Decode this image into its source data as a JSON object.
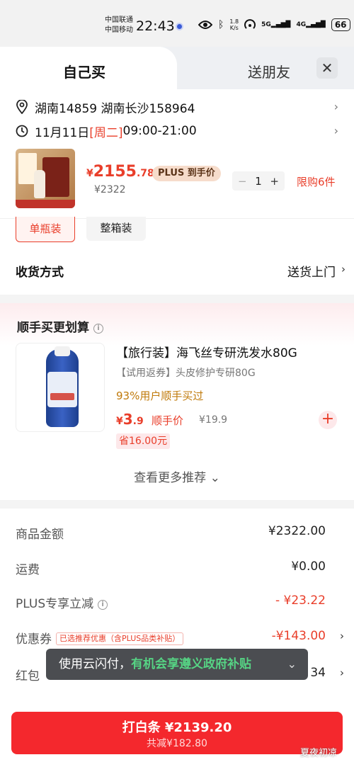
{
  "status_bar": {
    "carrier1": "中国联通",
    "carrier2": "中国移动",
    "time": "22:43",
    "speed_value": "1.8",
    "speed_unit": "K/s",
    "net1": "5G",
    "net2": "4G",
    "battery": "66"
  },
  "tabs": {
    "self_buy": "自己买",
    "gift": "送朋友",
    "close": "✕"
  },
  "delivery": {
    "address": "湖南14859  湖南长沙158964",
    "date": "11月11日 ",
    "weekday": "[周二]",
    "hours": " 09:00-21:00"
  },
  "product": {
    "price_yen": "¥",
    "price_int": "2155",
    "price_dec": ".78",
    "plus_badge": "PLUS 到手价",
    "original_price": "¥2322",
    "quantity": "1",
    "minus": "−",
    "plus": "+",
    "limit": "限购6件",
    "pack_single": "单瓶装",
    "pack_box": "整箱装"
  },
  "shipping": {
    "label": "收货方式",
    "value": "送货上门"
  },
  "upsell": {
    "title": "顺手买更划算",
    "info": "i",
    "name": "【旅行装】海飞丝专研洗发水80G",
    "subtitle": "【试用返券】头皮修护专研80G",
    "buyers": "93%用户顺手买过",
    "price_yen": "¥",
    "price_int": "3",
    "price_dec": ".9",
    "price_tag": "顺手价",
    "original_price": "¥19.9",
    "save": "省16.00元",
    "add": "+",
    "more": "查看更多推荐 ⌄"
  },
  "summary": {
    "goods_label": "商品金额",
    "goods_value": "¥2322.00",
    "freight_label": "运费",
    "freight_value": "¥0.00",
    "plus_label": "PLUS专享立减",
    "plus_value": "- ¥23.22",
    "coupon_label": "优惠券",
    "coupon_tag": "已选推荐优惠（含PLUS品类补贴）",
    "coupon_value": "-¥143.00",
    "redpacket_label": "红包",
    "redpacket_value": "34"
  },
  "toast": {
    "prefix": "使用云闪付，",
    "highlight": "有机会享遵义政府补贴",
    "arrow": "⌄"
  },
  "pay": {
    "main": "打白条 ¥2139.20",
    "sub": "共减¥182.80"
  },
  "watermark": "夏夜初凉",
  "colors": {
    "accent_red": "#e93e2a",
    "pay_red": "#f4282d",
    "gold": "#c07a0b",
    "toast_green": "#56d384"
  }
}
